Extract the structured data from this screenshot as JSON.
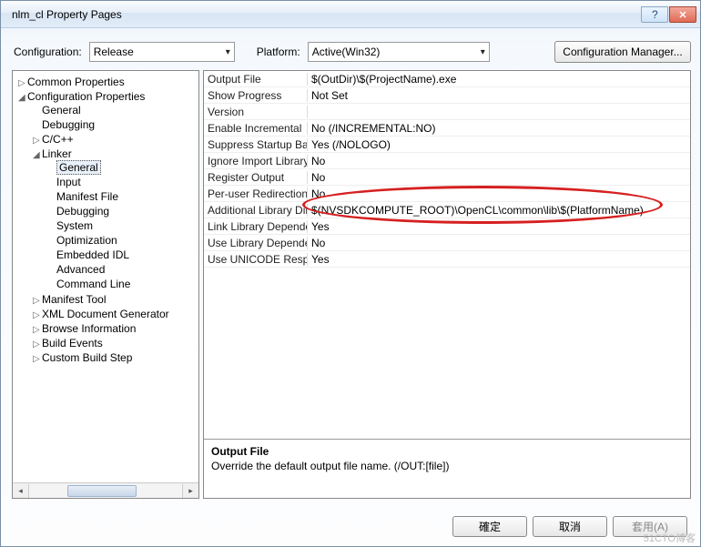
{
  "window": {
    "title": "nlm_cl Property Pages"
  },
  "configRow": {
    "configLabel": "Configuration:",
    "configValue": "Release",
    "platformLabel": "Platform:",
    "platformValue": "Active(Win32)",
    "managerBtn": "Configuration Manager..."
  },
  "tree": {
    "nodes": [
      {
        "label": "Common Properties",
        "expand": "▷"
      },
      {
        "label": "Configuration Properties",
        "expand": "◢",
        "children": [
          {
            "label": "General"
          },
          {
            "label": "Debugging"
          },
          {
            "label": "C/C++",
            "expand": "▷"
          },
          {
            "label": "Linker",
            "expand": "◢",
            "children": [
              {
                "label": "General",
                "sel": true
              },
              {
                "label": "Input"
              },
              {
                "label": "Manifest File"
              },
              {
                "label": "Debugging"
              },
              {
                "label": "System"
              },
              {
                "label": "Optimization"
              },
              {
                "label": "Embedded IDL"
              },
              {
                "label": "Advanced"
              },
              {
                "label": "Command Line"
              }
            ]
          },
          {
            "label": "Manifest Tool",
            "expand": "▷"
          },
          {
            "label": "XML Document Generator",
            "expand": "▷"
          },
          {
            "label": "Browse Information",
            "expand": "▷"
          },
          {
            "label": "Build Events",
            "expand": "▷"
          },
          {
            "label": "Custom Build Step",
            "expand": "▷"
          }
        ]
      }
    ]
  },
  "props": [
    {
      "name": "Output File",
      "value": "$(OutDir)\\$(ProjectName).exe"
    },
    {
      "name": "Show Progress",
      "value": "Not Set"
    },
    {
      "name": "Version",
      "value": ""
    },
    {
      "name": "Enable Incremental",
      "value": "No (/INCREMENTAL:NO)"
    },
    {
      "name": "Suppress Startup Banner",
      "value": "Yes (/NOLOGO)"
    },
    {
      "name": "Ignore Import Library",
      "value": "No"
    },
    {
      "name": "Register Output",
      "value": "No"
    },
    {
      "name": "Per-user Redirection",
      "value": "No"
    },
    {
      "name": "Additional Library Directories",
      "value": "$(NVSDKCOMPUTE_ROOT)\\OpenCL\\common\\lib\\$(PlatformName)"
    },
    {
      "name": "Link Library Dependencies",
      "value": "Yes"
    },
    {
      "name": "Use Library Dependency Inputs",
      "value": "No"
    },
    {
      "name": "Use UNICODE Response Files",
      "value": "Yes"
    }
  ],
  "desc": {
    "title": "Output File",
    "text": "Override the default output file name.     (/OUT:[file])"
  },
  "footer": {
    "ok": "確定",
    "cancel": "取消",
    "apply": "套用(A)"
  },
  "watermark": "51CTO博客"
}
